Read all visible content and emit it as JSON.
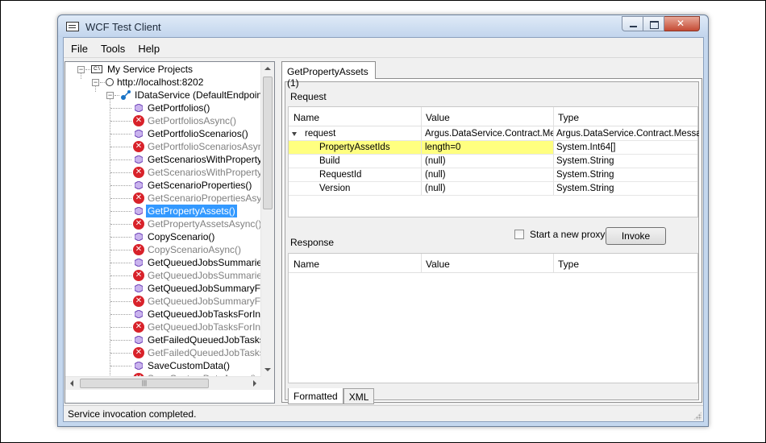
{
  "window": {
    "title": "WCF Test Client"
  },
  "menu": [
    "File",
    "Tools",
    "Help"
  ],
  "tree": {
    "root": "My Service Projects",
    "endpoint": "http://localhost:8202",
    "service": "IDataService (DefaultEndpoint)",
    "methods": [
      {
        "label": "GetPortfolios()",
        "async": false
      },
      {
        "label": "GetPortfoliosAsync()",
        "async": true
      },
      {
        "label": "GetPortfolioScenarios()",
        "async": false
      },
      {
        "label": "GetPortfolioScenariosAsync()",
        "async": true
      },
      {
        "label": "GetScenariosWithPropertyAss",
        "async": false
      },
      {
        "label": "GetScenariosWithPropertyAss",
        "async": true
      },
      {
        "label": "GetScenarioProperties()",
        "async": false
      },
      {
        "label": "GetScenarioPropertiesAsync()",
        "async": true
      },
      {
        "label": "GetPropertyAssets()",
        "async": false,
        "selected": true
      },
      {
        "label": "GetPropertyAssetsAsync()",
        "async": true
      },
      {
        "label": "CopyScenario()",
        "async": false
      },
      {
        "label": "CopyScenarioAsync()",
        "async": true
      },
      {
        "label": "GetQueuedJobsSummariesFor",
        "async": false
      },
      {
        "label": "GetQueuedJobsSummariesFor",
        "async": true
      },
      {
        "label": "GetQueuedJobSummaryForInt",
        "async": false
      },
      {
        "label": "GetQueuedJobSummaryForInt",
        "async": true
      },
      {
        "label": "GetQueuedJobTasksForIntegr",
        "async": false
      },
      {
        "label": "GetQueuedJobTasksForIntegr",
        "async": true
      },
      {
        "label": "GetFailedQueuedJobTasksFor",
        "async": false
      },
      {
        "label": "GetFailedQueuedJobTasksFor",
        "async": true
      },
      {
        "label": "SaveCustomData()",
        "async": false
      },
      {
        "label": "SaveCustomDataAsync()",
        "async": true
      }
    ]
  },
  "tab": {
    "label": "GetPropertyAssets (1)"
  },
  "request": {
    "label": "Request",
    "columns": [
      "Name",
      "Value",
      "Type"
    ],
    "rows": [
      {
        "name": "request",
        "value": "Argus.DataService.Contract.Mess",
        "type": "Argus.DataService.Contract.Message",
        "expandable": true
      },
      {
        "name": "PropertyAssetIds",
        "value": "length=0",
        "type": "System.Int64[]",
        "highlight": true
      },
      {
        "name": "Build",
        "value": "(null)",
        "type": "System.String"
      },
      {
        "name": "RequestId",
        "value": "(null)",
        "type": "System.String"
      },
      {
        "name": "Version",
        "value": "(null)",
        "type": "System.String"
      }
    ]
  },
  "proxy": {
    "label": "Start a new proxy",
    "checked": false
  },
  "invoke": {
    "label": "Invoke"
  },
  "response": {
    "label": "Response",
    "columns": [
      "Name",
      "Value",
      "Type"
    ]
  },
  "bottom_tabs": [
    {
      "label": "Formatted",
      "active": true
    },
    {
      "label": "XML",
      "active": false
    }
  ],
  "status": {
    "text": "Service invocation completed."
  }
}
